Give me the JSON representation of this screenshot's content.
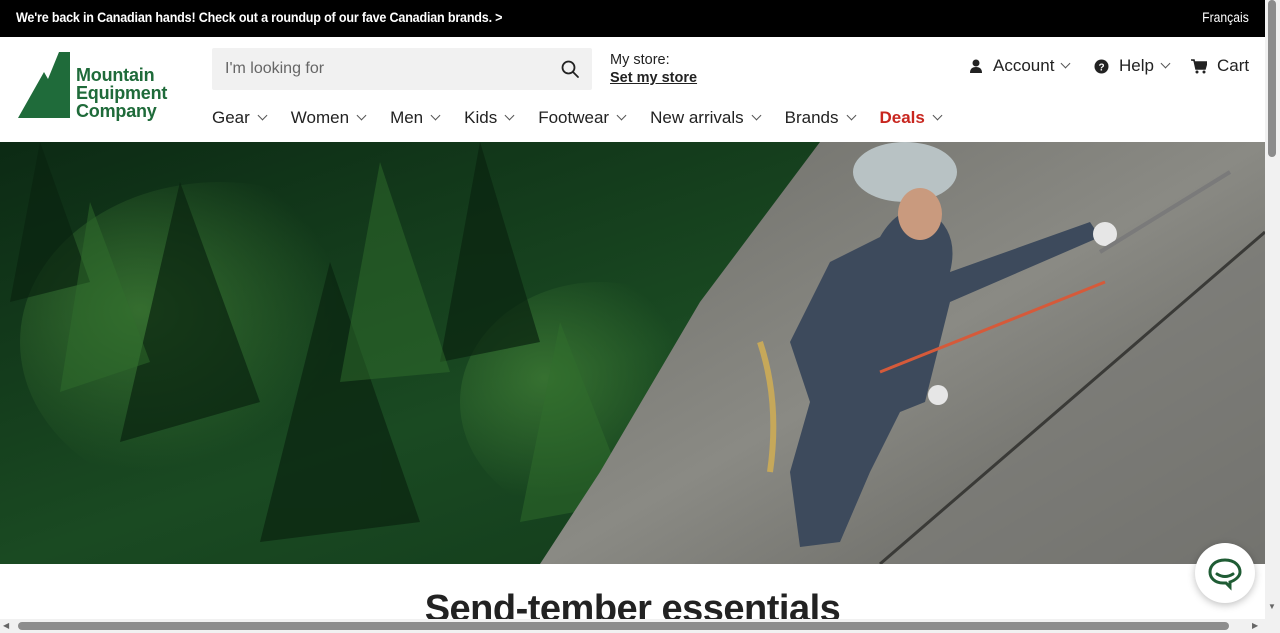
{
  "announcement": {
    "message": "We're back in Canadian hands! Check out a roundup of our fave Canadian brands. >",
    "language": "Français"
  },
  "logo": {
    "line1": "Mountain",
    "line2": "Equipment",
    "line3": "Company",
    "color": "#1f6b3a"
  },
  "search": {
    "placeholder": "I'm looking for"
  },
  "store": {
    "label": "My store:",
    "link": "Set my store"
  },
  "utility": {
    "account": "Account",
    "help": "Help",
    "cart": "Cart"
  },
  "nav": {
    "items": [
      {
        "label": "Gear"
      },
      {
        "label": "Women"
      },
      {
        "label": "Men"
      },
      {
        "label": "Kids"
      },
      {
        "label": "Footwear"
      },
      {
        "label": "New arrivals"
      },
      {
        "label": "Brands"
      },
      {
        "label": "Deals"
      }
    ],
    "deals_color": "#c8261f"
  },
  "section": {
    "title": "Send-tember essentials"
  }
}
